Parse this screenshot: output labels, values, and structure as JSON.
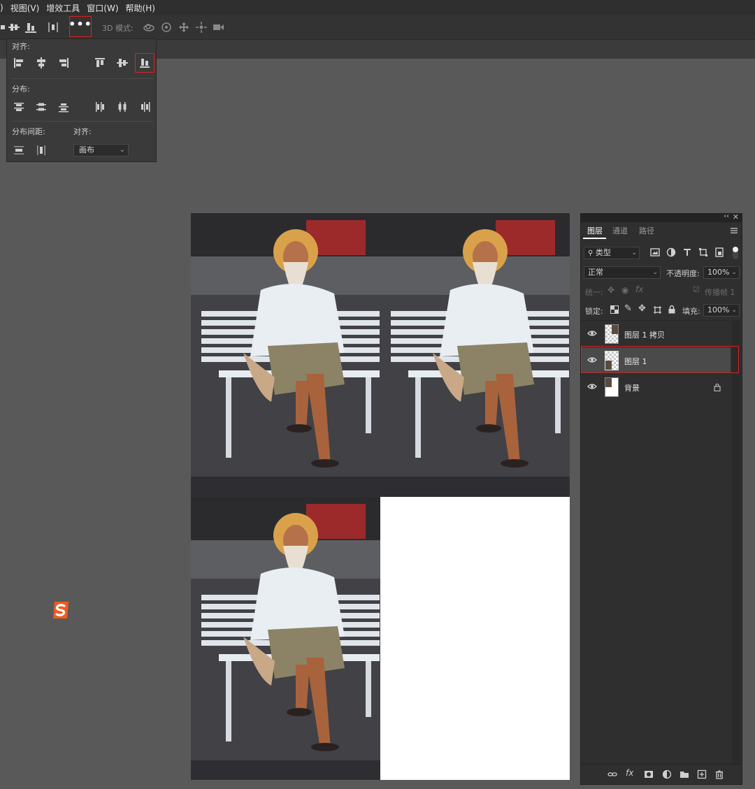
{
  "menubar": {
    "items": [
      ")",
      "视图(V)",
      "增效工具",
      "窗口(W)",
      "帮助(H)"
    ]
  },
  "optionsbar": {
    "more_label": "•••",
    "mode_3d_label": "3D 模式:"
  },
  "align_panel": {
    "align_label": "对齐:",
    "distribute_label": "分布:",
    "distribute_spacing_label": "分布间距:",
    "align_to_label": "对齐:",
    "align_to_value": "画布",
    "icons": {
      "align_row": [
        "align-left-edges-icon",
        "align-horizontal-centers-icon",
        "align-right-edges-icon",
        "align-top-edges-icon",
        "align-vertical-centers-icon",
        "align-bottom-edges-icon"
      ],
      "distribute_row": [
        "distribute-top-icon",
        "distribute-vertical-center-icon",
        "distribute-bottom-icon",
        "distribute-left-icon",
        "distribute-horizontal-center-icon",
        "distribute-right-icon"
      ],
      "spacing_row": [
        "distribute-vertical-spacing-icon",
        "distribute-horizontal-spacing-icon"
      ]
    }
  },
  "layers_panel": {
    "tabs": [
      "图层",
      "通道",
      "路径"
    ],
    "active_tab": "图层",
    "filter_value": "类型",
    "blend_mode": "正常",
    "opacity_label": "不透明度:",
    "opacity_value": "100%",
    "unify_label": "统一:",
    "propagate_label": "传播帧 1",
    "lock_label": "锁定:",
    "fill_label": "填充:",
    "fill_value": "100%",
    "layers": [
      {
        "name": "图层 1 拷贝",
        "visible": true,
        "selected": false,
        "locked": false
      },
      {
        "name": "图层 1",
        "visible": true,
        "selected": true,
        "locked": false
      },
      {
        "name": "背景",
        "visible": true,
        "selected": false,
        "locked": true
      }
    ],
    "highlight_color": "#e02020"
  },
  "colors": {
    "workspace": "#595959",
    "panel": "#2f2f2f",
    "highlight": "#e02020"
  }
}
